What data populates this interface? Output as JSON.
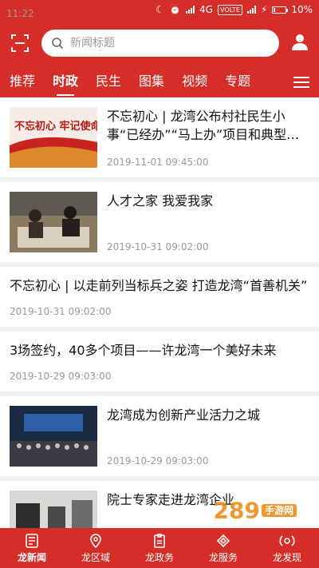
{
  "status": {
    "time": "11:22",
    "network": "4G",
    "volte": "VOLTE",
    "battery": "10%"
  },
  "header": {
    "search_placeholder": "新闻标题"
  },
  "tabs": [
    {
      "label": "推荐"
    },
    {
      "label": "时政",
      "active": true
    },
    {
      "label": "民生"
    },
    {
      "label": "图集"
    },
    {
      "label": "视频"
    },
    {
      "label": "专题"
    }
  ],
  "feed": [
    {
      "title": "不忘初心 | 龙湾公布村社民生小事“已经办”“马上办”项目和典型…",
      "time": "2019-11-01 09:45:00",
      "thumb_text": "不忘初心 牢记使命"
    },
    {
      "title": "人才之家 我爱我家",
      "time": "2019-10-31 09:02:00"
    },
    {
      "title": "不忘初心 | 以走前列当标兵之姿 打造龙湾“首善机关”",
      "time": "2019-10-31 09:02:00"
    },
    {
      "title": "3场签约，40多个项目——许龙湾一个美好未来",
      "time": "2019-10-29 09:03:00"
    },
    {
      "title": "龙湾成为创新产业活力之城",
      "time": "2019-10-29 09:03:00"
    },
    {
      "title": "院士专家走进龙湾企业",
      "time": ""
    }
  ],
  "tabbar": [
    {
      "label": "龙新闻",
      "icon": "news-icon"
    },
    {
      "label": "龙区域",
      "icon": "location-icon"
    },
    {
      "label": "龙政务",
      "icon": "document-icon"
    },
    {
      "label": "龙服务",
      "icon": "service-icon"
    },
    {
      "label": "龙发现",
      "icon": "discover-icon"
    }
  ],
  "watermark": {
    "brand": "289",
    "suffix": "手游网"
  },
  "colors": {
    "brand": "#d52d27",
    "divider": "#f1f1f1",
    "time": "#999999"
  }
}
